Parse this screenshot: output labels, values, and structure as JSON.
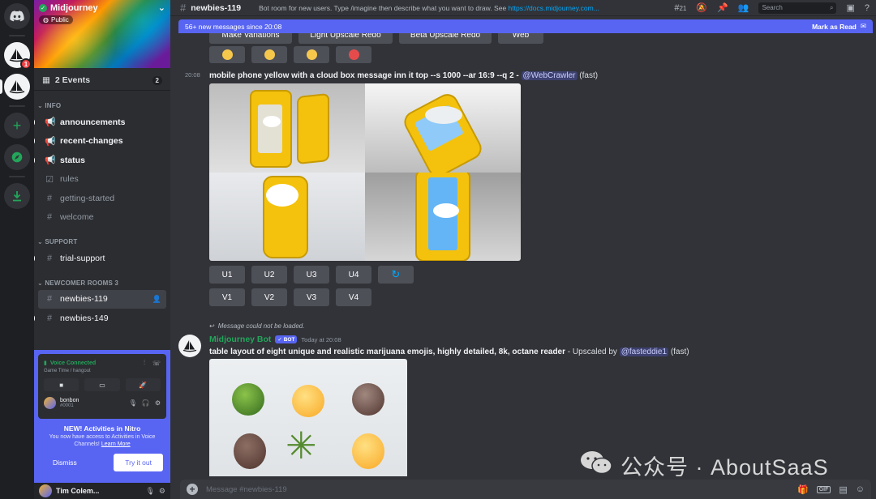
{
  "server": {
    "name": "Midjourney",
    "public_label": "Public",
    "badge_count": "1"
  },
  "events": {
    "label": "2 Events",
    "count": "2"
  },
  "categories": {
    "info": "INFO",
    "support": "SUPPORT",
    "newcomer": "NEWCOMER ROOMS 3"
  },
  "channels": {
    "announcements": "announcements",
    "recent_changes": "recent-changes",
    "status": "status",
    "rules": "rules",
    "getting_started": "getting-started",
    "welcome": "welcome",
    "trial_support": "trial-support",
    "newbies_119": "newbies-119",
    "newbies_149": "newbies-149"
  },
  "voice": {
    "connected": "Voice Connected",
    "location": "Game Time / hangout",
    "user_name": "bonbon",
    "user_tag": "#0001"
  },
  "nitro": {
    "title": "NEW! Activities in Nitro",
    "desc": "You now have access to Activities in Voice Channels!",
    "learn_more": "Learn More",
    "dismiss": "Dismiss",
    "try": "Try it out"
  },
  "user": {
    "name": "Tim Colem..."
  },
  "header": {
    "channel": "newbies-119",
    "topic": "Bot room for new users. Type /imagine then describe what you want to draw. See",
    "link": "https://docs.midjourney.com...",
    "threads_count": "21",
    "search_placeholder": "Search"
  },
  "newbar": {
    "text": "56+ new messages since 20:08",
    "mark_read": "Mark as Read"
  },
  "top_buttons": [
    "Make Variations",
    "Light Upscale Redo",
    "Beta Upscale Redo",
    "Web"
  ],
  "message1": {
    "time": "20:08",
    "prompt": "mobile phone yellow with a cloud box message inn it top --s 1000 --ar 16:9 --q 2 -",
    "mention": "@WebCrawler",
    "speed": "(fast)"
  },
  "upscale_buttons": [
    "U1",
    "U2",
    "U3",
    "U4"
  ],
  "variation_buttons": [
    "V1",
    "V2",
    "V3",
    "V4"
  ],
  "message2": {
    "reply_note": "Message could not be loaded.",
    "author": "Midjourney Bot",
    "bot_tag": "BOT",
    "time": "Today at 20:08",
    "prompt": "table layout of eight unique and realistic marijuana emojis, highly detailed, 8k, octane reader",
    "suffix": "- Upscaled by",
    "mention": "@fasteddie1",
    "speed": "(fast)"
  },
  "watermark": {
    "text": "公众号 · AboutSaaS"
  },
  "composer": {
    "placeholder": "Message #newbies-119"
  },
  "colors": {
    "blurple": "#5865f2",
    "green": "#23a55a",
    "bg": "#313338",
    "sidebar": "#2b2d31",
    "rail": "#1e1f22"
  }
}
